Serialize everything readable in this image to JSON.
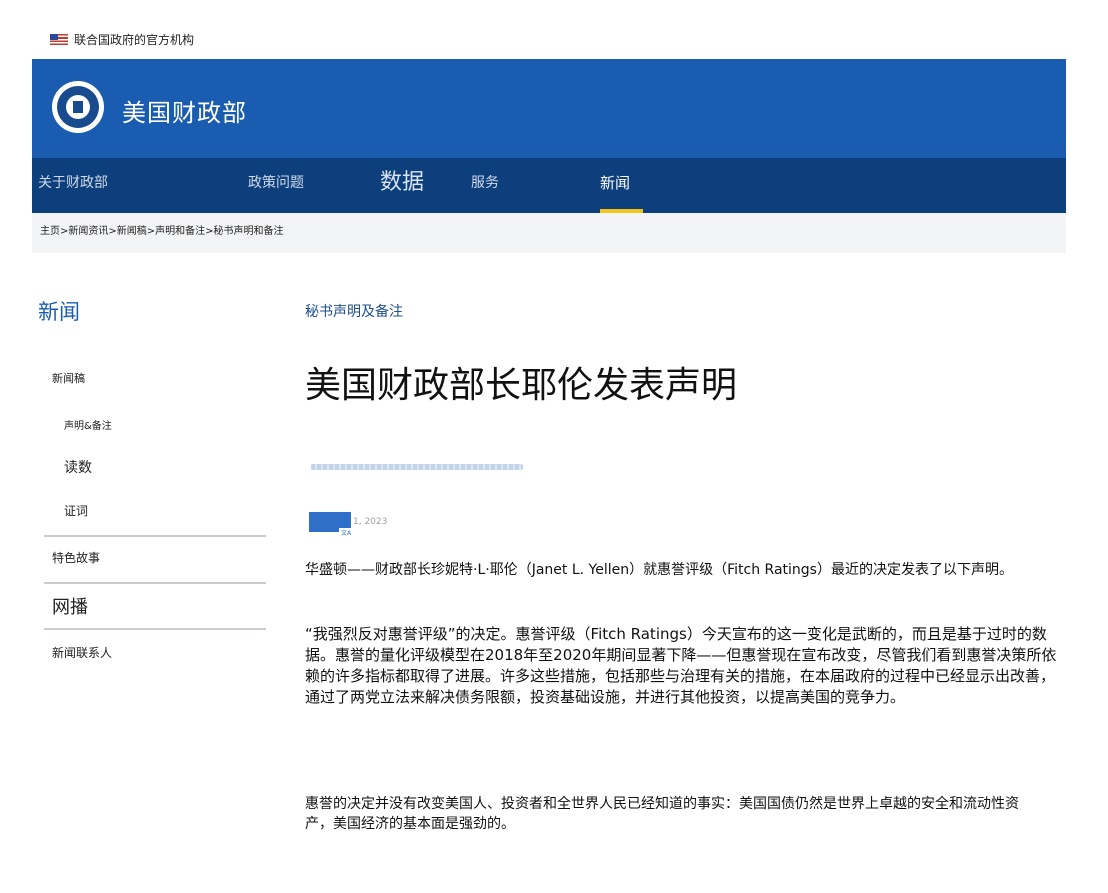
{
  "gov_banner": {
    "text": "联合国政府的官方机构"
  },
  "header": {
    "title": "美国财政部"
  },
  "nav": {
    "items": [
      {
        "label": "关于财政部"
      },
      {
        "label": "政策问题"
      },
      {
        "label": "数据"
      },
      {
        "label": "服务"
      },
      {
        "label": "新闻"
      }
    ],
    "active": "新闻",
    "accent_color": "#f2c31a"
  },
  "breadcrumb": "主页>新闻资讯>新闻稿>声明和备注>秘书声明和备注",
  "sidebar": {
    "title": "新闻",
    "items": [
      {
        "label": "新闻稿"
      },
      {
        "label": "声明&备注"
      },
      {
        "label": "读数"
      },
      {
        "label": "证词"
      },
      {
        "label": "特色故事"
      },
      {
        "label": "网播"
      },
      {
        "label": "新闻联系人"
      }
    ]
  },
  "article": {
    "kicker": "秘书声明及备注",
    "headline": "美国财政部长耶伦发表声明",
    "date": "1, 2023",
    "paragraphs": [
      "华盛顿——财政部长珍妮特·L·耶伦（Janet L. Yellen）就惠誉评级（Fitch Ratings）最近的决定发表了以下声明。",
      "“我强烈反对惠誉评级”的决定。惠誉评级（Fitch Ratings）今天宣布的这一变化是武断的，而且是基于过时的数据。惠誉的量化评级模型在2018年至2020年期间显著下降——但惠誉现在宣布改变，尽管我们看到惠誉决策所依赖的许多指标都取得了进展。许多这些措施，包括那些与治理有关的措施，在本届政府的过程中已经显示出改善，通过了两党立法来解决债务限额，投资基础设施，并进行其他投资，以提高美国的竞争力。",
      "惠誉的决定并没有改变美国人、投资者和全世界人民已经知道的事实：美国国债仍然是世界上卓越的安全和流动性资产，美国经济的基本面是强劲的。"
    ]
  },
  "colors": {
    "header_blue": "#1a5cb0",
    "nav_blue": "#0d3f7c"
  }
}
